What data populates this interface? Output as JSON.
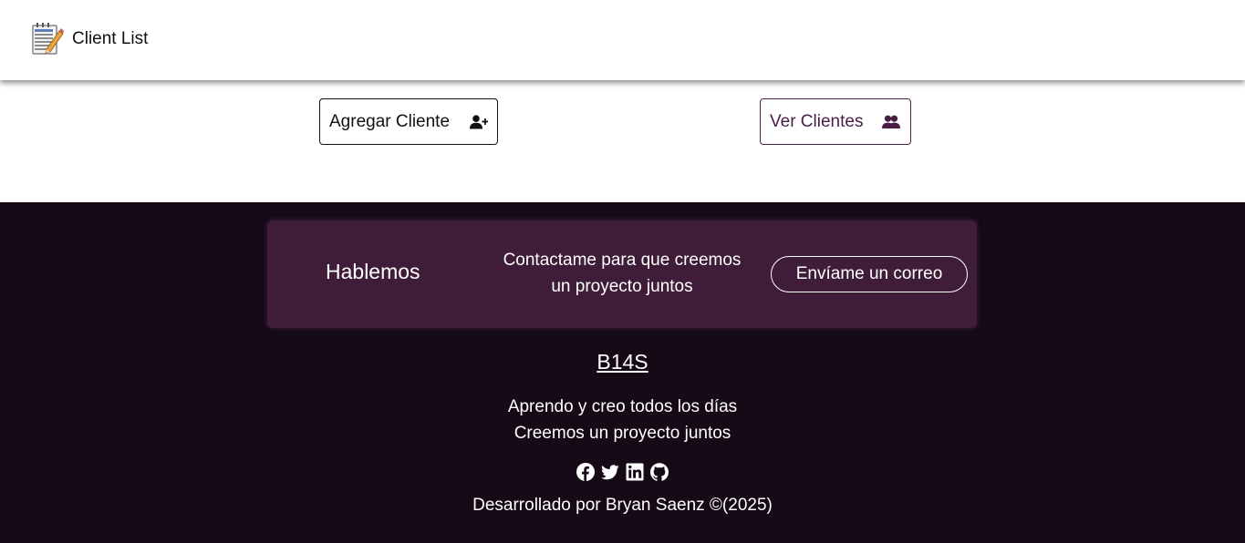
{
  "header": {
    "app_title": "Client List",
    "logo_icon": "notepad-pencil-icon"
  },
  "actions": {
    "add_client_label": "Agregar Cliente",
    "add_client_icon": "user-plus-icon",
    "view_clients_label": "Ver Clientes",
    "view_clients_icon": "users-icon"
  },
  "footer": {
    "cta_title": "Hablemos",
    "cta_text_line1": "Contactame para que creemos",
    "cta_text_line2": "un proyecto juntos",
    "cta_button_label": "Envíame un correo",
    "brand": "B14S",
    "tagline_line1": "Aprendo y creo todos los días",
    "tagline_line2": "Creemos un proyecto juntos",
    "social_icons": [
      "facebook-icon",
      "twitter-icon",
      "linkedin-icon",
      "github-icon"
    ],
    "credit": "Desarrollado por Bryan Saenz ©(2025)"
  },
  "colors": {
    "footer_bg": "#150a16",
    "cta_bg": "#3f1c38",
    "accent": "#4a1d44"
  }
}
